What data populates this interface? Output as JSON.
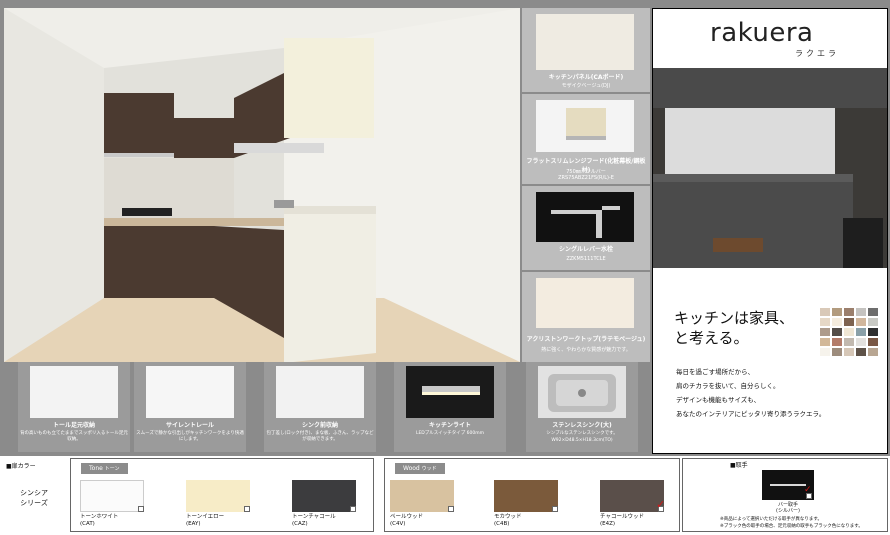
{
  "brand": {
    "logo": "rakuera",
    "logo_kana": "ラクエラ",
    "headline_line1": "キッチンは家具、",
    "headline_line2": "と考える。",
    "body_lines": [
      "毎日を過ごす場所だから、",
      "肩のチカラを抜いて、自分らしく。",
      "デザインも機能もサイズも、",
      "あなたのインテリアにピッタリ寄り添うラクエラ。"
    ]
  },
  "side_cards": [
    {
      "title": "キッチンパネル(CAボード)",
      "sub": "モザイクベージュ(DJ)"
    },
    {
      "title": "フラットスリムレンジフード(化粧幕板/鋼板材)",
      "sub": "750㎜／シルバー",
      "sub2": "ZRS75ABZ21FS(R/L)-E"
    },
    {
      "title": "シングルレバー水栓",
      "sub": "ZZKM5111TCLE"
    },
    {
      "title": "アクリストンワークトップ(ラテモベージュ)",
      "sub": "熱に強く、やわらかな質感が魅力です。"
    }
  ],
  "bottom_cards": [
    {
      "title": "トール足元収納",
      "desc": "背の高いものも立てたままでスッポリ入るトール足元収納。"
    },
    {
      "title": "サイレントレール",
      "desc": "スムーズで静かな引出しがキッチンワークをより快適にします。"
    },
    {
      "title": "シンク前収納",
      "desc": "包丁差し(ロック付き)、まな板、ふきん、ラップなどが収納できます。"
    },
    {
      "title": "キッチンライト",
      "desc": "LEDプルスイッチタイプ 600mm"
    },
    {
      "title": "ステンレスシンク(大)",
      "desc": "シンプルなステンレスシンクです。",
      "desc2": "W92×D48.5×H18.3cm(TO)"
    }
  ],
  "color_section": {
    "label": "■扉カラー",
    "series_line1": "シンシア",
    "series_line2": "シリーズ",
    "tone_head": "Tone",
    "tone_head_kana": "トーン",
    "wood_head": "Wood",
    "wood_head_kana": "ウッド",
    "tone": [
      {
        "name": "トーンホワイト",
        "code": "(CAT)",
        "color": "#fbfbfb",
        "selected": false
      },
      {
        "name": "トーンイエロー",
        "code": "(EAY)",
        "color": "#f7ecc7",
        "selected": false
      },
      {
        "name": "トーンチャコール",
        "code": "(CAZ)",
        "color": "#3c3c3e",
        "selected": false
      }
    ],
    "wood": [
      {
        "name": "ペールウッド",
        "code": "(C4V)",
        "color": "#d8c2a0",
        "selected": false
      },
      {
        "name": "モカウッド",
        "code": "(C4B)",
        "color": "#7b5a3b",
        "selected": false
      },
      {
        "name": "チャコールウッド",
        "code": "(E4Z)",
        "color": "#5a4f4a",
        "selected": true
      }
    ],
    "handle_label": "■取手",
    "handle_name": "バー取手",
    "handle_sub": "(シルバー)",
    "notes": [
      "※商品によって選択いただける取手が異なります。",
      "※ブラック色の取手の場合、足元収納の取手もブラック色になります。"
    ]
  }
}
